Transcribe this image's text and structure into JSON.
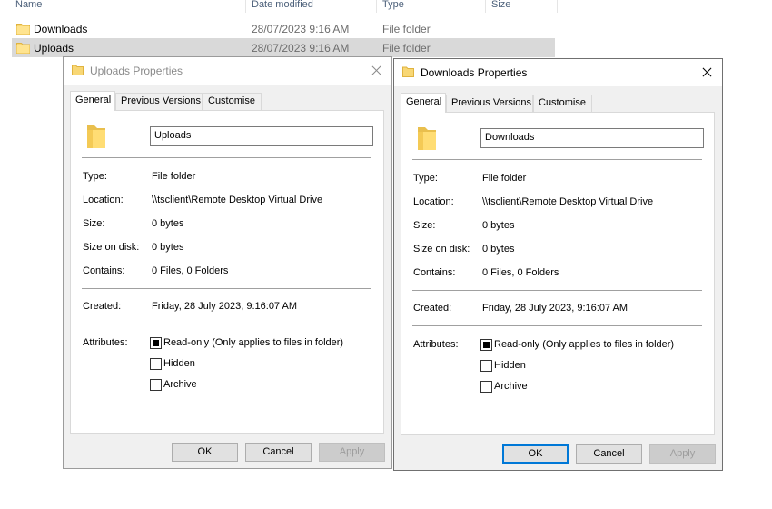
{
  "explorer": {
    "columns": [
      "Name",
      "Date modified",
      "Type",
      "Size"
    ],
    "rows": [
      {
        "name": "Downloads",
        "date": "28/07/2023 9:16 AM",
        "type": "File folder"
      },
      {
        "name": "Uploads",
        "date": "28/07/2023 9:16 AM",
        "type": "File folder"
      }
    ]
  },
  "tabs": [
    "General",
    "Previous Versions",
    "Customise"
  ],
  "labels": {
    "type": "Type:",
    "location": "Location:",
    "size": "Size:",
    "size_on_disk": "Size on disk:",
    "contains": "Contains:",
    "created": "Created:",
    "attributes": "Attributes:",
    "readonly": "Read-only (Only applies to files in folder)",
    "hidden": "Hidden",
    "archive": "Archive"
  },
  "buttons": {
    "ok": "OK",
    "cancel": "Cancel",
    "apply": "Apply"
  },
  "dialogs": [
    {
      "title": "Uploads Properties",
      "folder_name": "Uploads",
      "type": "File folder",
      "location": "\\\\tsclient\\Remote Desktop Virtual Drive",
      "size": "0 bytes",
      "size_on_disk": "0 bytes",
      "contains": "0 Files, 0 Folders",
      "created": "Friday, 28 July 2023, 9:16:07 AM"
    },
    {
      "title": "Downloads Properties",
      "folder_name": "Downloads",
      "type": "File folder",
      "location": "\\\\tsclient\\Remote Desktop Virtual Drive",
      "size": "0 bytes",
      "size_on_disk": "0 bytes",
      "contains": "0 Files, 0 Folders",
      "created": "Friday, 28 July 2023, 9:16:07 AM"
    }
  ],
  "colors": {
    "selection": "#d9d9d9",
    "accent": "#0078d7",
    "dialog_bg": "#f0f0f0"
  },
  "icons": {
    "folder": "folder-icon",
    "close": "close-icon"
  }
}
